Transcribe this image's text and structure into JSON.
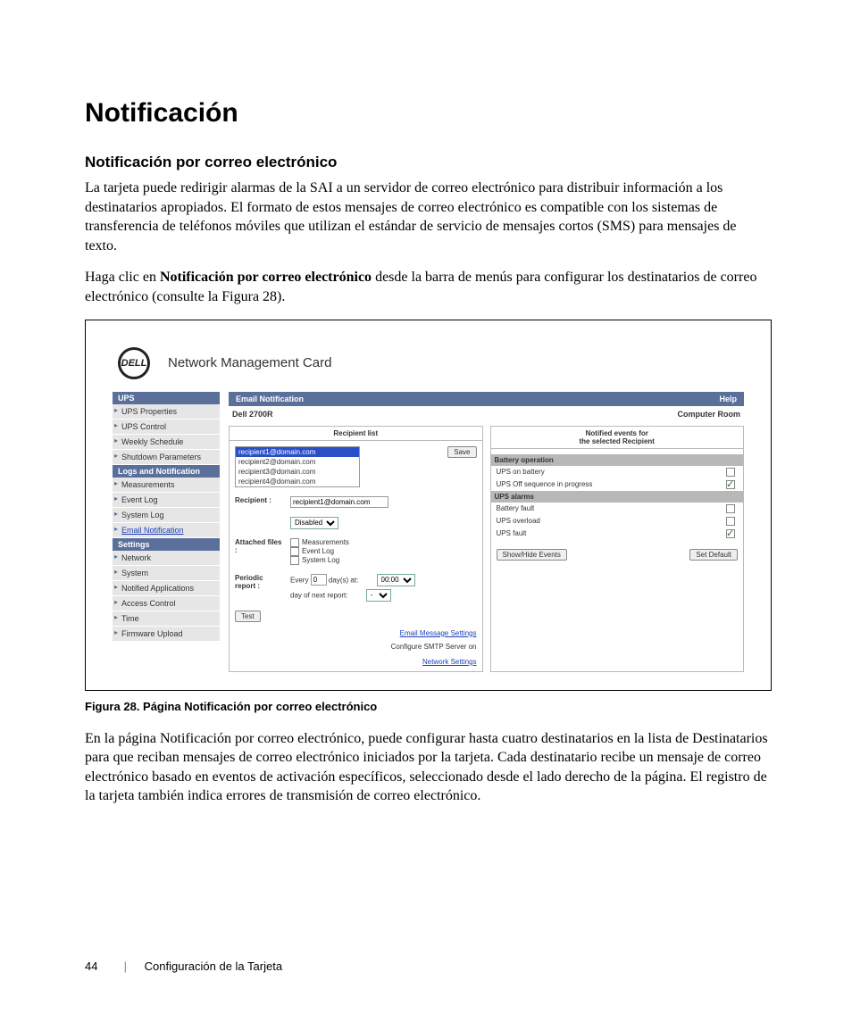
{
  "page": {
    "h1": "Notificación",
    "h2": "Notificación por correo electrónico",
    "p1": "La tarjeta puede redirigir alarmas de la SAI a un servidor de correo electrónico para distribuir información a los destinatarios apropiados. El formato de estos mensajes de correo electrónico es compatible con los sistemas de transferencia de teléfonos móviles que utilizan el estándar de servicio de mensajes cortos (SMS) para mensajes de texto.",
    "p2a": "Haga clic en ",
    "p2b": "Notificación por correo electrónico",
    "p2c": " desde la barra de menús para configurar los destinatarios de correo electrónico (consulte la Figura 28).",
    "caption": "Figura 28.  Página Notificación por correo electrónico",
    "p3": "En la página Notificación por correo electrónico, puede configurar hasta cuatro destinatarios en la lista de Destinatarios para que reciban mensajes de correo electrónico iniciados por la tarjeta. Cada destinatario recibe un mensaje de correo electrónico basado en eventos de activación específicos, seleccionado desde el lado derecho de la página. El registro de la tarjeta también indica errores de transmisión de correo electrónico.",
    "footer_page": "44",
    "footer_title": "Configuración de la Tarjeta"
  },
  "ui": {
    "logo": "DELL",
    "title": "Network Management Card",
    "nav": {
      "s1": "UPS",
      "s1_items": [
        "UPS Properties",
        "UPS Control",
        "Weekly Schedule",
        "Shutdown Parameters"
      ],
      "s2": "Logs and Notification",
      "s2_items": [
        "Measurements",
        "Event Log",
        "System Log"
      ],
      "s2_active": "Email Notification",
      "s3": "Settings",
      "s3_items": [
        "Network",
        "System",
        "Notified Applications",
        "Access Control",
        "Time",
        "Firmware Upload"
      ]
    },
    "bar_title": "Email Notification",
    "bar_help": "Help",
    "sub_left": "Dell 2700R",
    "sub_right": "Computer Room",
    "left_panel": {
      "head": "Recipient list",
      "recips": [
        "recipient1@domain.com",
        "recipient2@domain.com",
        "recipient3@domain.com",
        "recipient4@domain.com"
      ],
      "save": "Save",
      "recipient_lbl": "Recipient :",
      "recipient_val": "recipient1@domain.com",
      "status": "Disabled",
      "attached_lbl": "Attached files :",
      "att1": "Measurements",
      "att2": "Event Log",
      "att3": "System Log",
      "periodic_lbl": "Periodic report :",
      "every": "Every",
      "days": "day(s) at:",
      "every_val": "0",
      "time": "00:00",
      "nextrep": "day of next report:",
      "nextrep_val": "-",
      "test": "Test",
      "link1": "Email Message Settings",
      "cfg_txt": "Configure SMTP Server on",
      "link2": "Network Settings"
    },
    "right_panel": {
      "head1": "Notified events for",
      "head2": "the selected Recipient",
      "grp1": "Battery operation",
      "ev1": "UPS on battery",
      "ev2": "UPS Off sequence in progress",
      "grp2": "UPS alarms",
      "ev3": "Battery fault",
      "ev4": "UPS overload",
      "ev5": "UPS fault",
      "btn1": "Show/Hide Events",
      "btn2": "Set Default"
    }
  }
}
